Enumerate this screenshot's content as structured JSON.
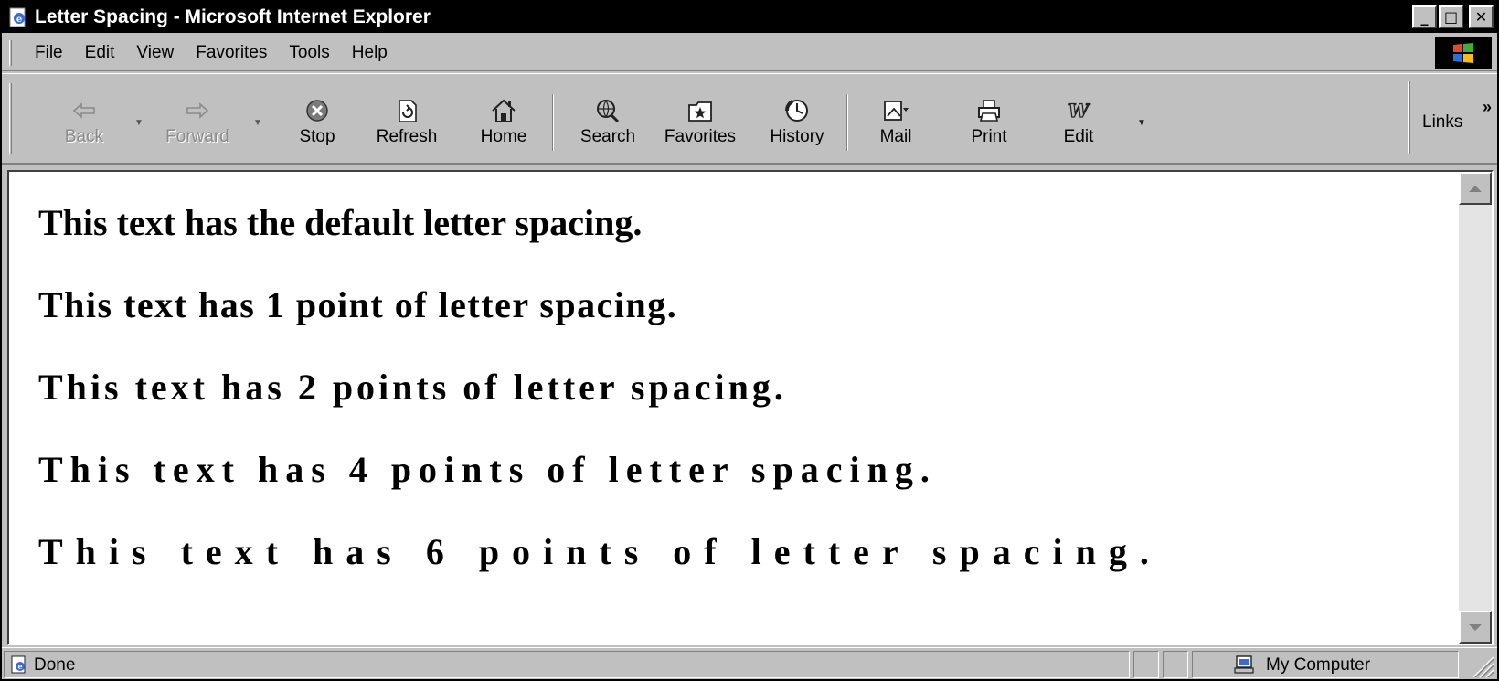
{
  "window": {
    "title": "Letter Spacing - Microsoft Internet Explorer",
    "controls": {
      "minimize": "_",
      "maximize": "□",
      "close": "✕"
    }
  },
  "menu": {
    "items": [
      {
        "label": "File",
        "accel": "F",
        "rest": "ile",
        "pre": ""
      },
      {
        "label": "Edit",
        "accel": "E",
        "rest": "dit",
        "pre": ""
      },
      {
        "label": "View",
        "accel": "V",
        "rest": "iew",
        "pre": ""
      },
      {
        "label": "Favorites",
        "accel": "a",
        "rest": "vorites",
        "pre": "F"
      },
      {
        "label": "Tools",
        "accel": "T",
        "rest": "ools",
        "pre": ""
      },
      {
        "label": "Help",
        "accel": "H",
        "rest": "elp",
        "pre": ""
      }
    ]
  },
  "toolbar": {
    "back": "Back",
    "forward": "Forward",
    "stop": "Stop",
    "refresh": "Refresh",
    "home": "Home",
    "search": "Search",
    "favorites": "Favorites",
    "history": "History",
    "mail": "Mail",
    "print": "Print",
    "edit": "Edit",
    "links": "Links",
    "links_chevron": "»"
  },
  "content": {
    "lines": [
      "This text has the default letter spacing.",
      "This text has 1 point of letter spacing.",
      "This text has 2 points of letter spacing.",
      "This text has 4 points of letter spacing.",
      "This text has 6 points of letter spacing."
    ]
  },
  "status": {
    "text": "Done",
    "zone": "My Computer"
  },
  "icons": {
    "app": "ie-page-icon",
    "throbber": "windows-logo-icon",
    "back": "back-arrow-icon",
    "forward": "forward-arrow-icon",
    "stop": "stop-icon",
    "refresh": "refresh-icon",
    "home": "home-icon",
    "search": "search-globe-icon",
    "favorites": "favorites-folder-icon",
    "history": "history-icon",
    "mail": "mail-icon",
    "print": "printer-icon",
    "edit": "word-edit-icon",
    "status": "page-done-icon",
    "zone": "computer-icon"
  }
}
